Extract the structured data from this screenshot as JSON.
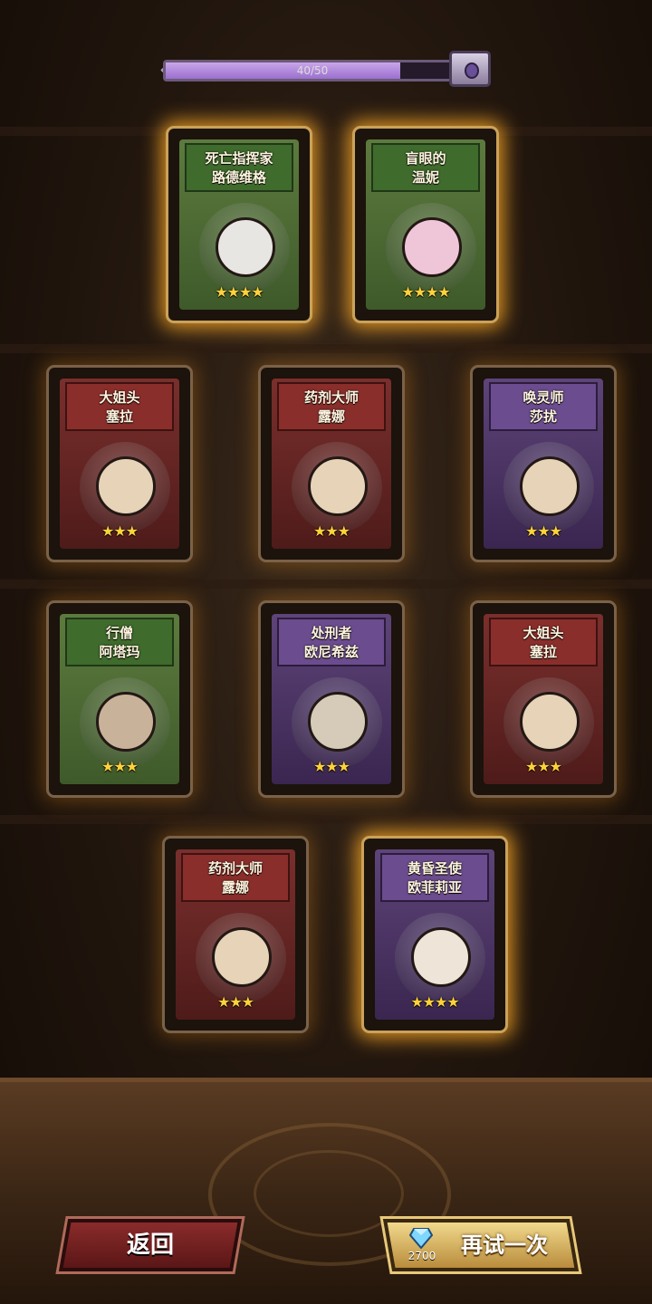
{
  "progress": {
    "text": "40/50",
    "value": 0.8
  },
  "cards": [
    {
      "line1": "死亡指挥家",
      "line2": "路德维格",
      "stars": "★★★★",
      "theme": "green"
    },
    {
      "line1": "盲眼的",
      "line2": "温妮",
      "stars": "★★★★",
      "theme": "green"
    },
    {
      "line1": "大姐头",
      "line2": "塞拉",
      "stars": "★★★",
      "theme": "red"
    },
    {
      "line1": "药剂大师",
      "line2": "露娜",
      "stars": "★★★",
      "theme": "red"
    },
    {
      "line1": "唤灵师",
      "line2": "莎扰",
      "stars": "★★★",
      "theme": "purple"
    },
    {
      "line1": "行僧",
      "line2": "阿塔玛",
      "stars": "★★★",
      "theme": "green"
    },
    {
      "line1": "处刑者",
      "line2": "欧尼希兹",
      "stars": "★★★",
      "theme": "purple"
    },
    {
      "line1": "大姐头",
      "line2": "塞拉",
      "stars": "★★★",
      "theme": "red"
    },
    {
      "line1": "药剂大师",
      "line2": "露娜",
      "stars": "★★★",
      "theme": "red"
    },
    {
      "line1": "黄昏圣使",
      "line2": "欧菲莉亚",
      "stars": "★★★★",
      "theme": "purple"
    }
  ],
  "buttons": {
    "back_label": "返回",
    "retry_label": "再试一次",
    "retry_cost": "2700",
    "cost_icon": "diamond-icon"
  },
  "colors": {
    "gold_glow": "#ffaa28",
    "progress_fill": "#b58be0"
  }
}
